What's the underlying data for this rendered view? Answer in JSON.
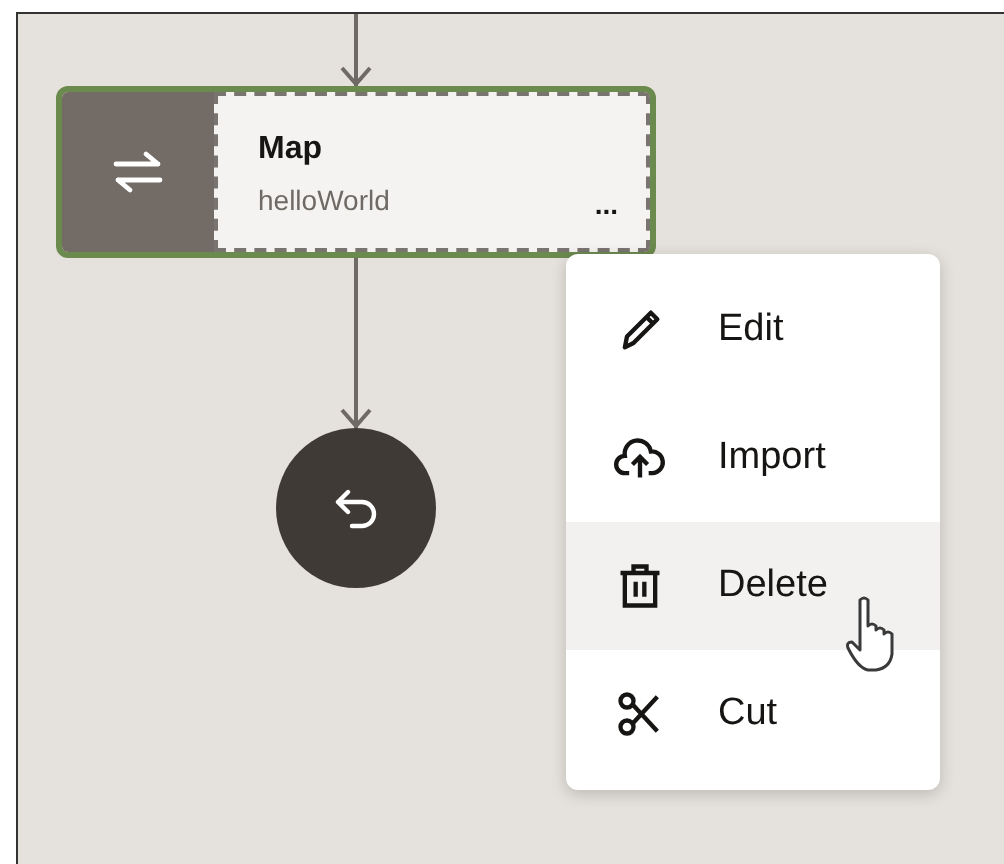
{
  "node": {
    "title": "Map",
    "subtitle": "helloWorld",
    "more": "...",
    "selected": true
  },
  "menu": {
    "items": [
      {
        "kind": "edit",
        "label": "Edit",
        "highlighted": false
      },
      {
        "kind": "import",
        "label": "Import",
        "highlighted": false
      },
      {
        "kind": "delete",
        "label": "Delete",
        "highlighted": true
      },
      {
        "kind": "cut",
        "label": "Cut",
        "highlighted": false
      }
    ]
  }
}
